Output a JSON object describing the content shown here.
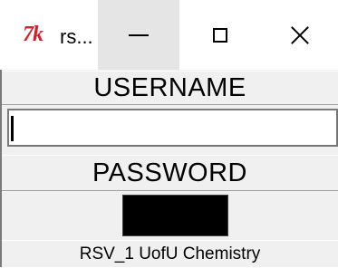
{
  "window": {
    "title": "rs...",
    "icon": "tk-icon",
    "icon_text": "7k",
    "controls": {
      "minimize": "minimize-icon",
      "maximize": "maximize-icon",
      "close": "close-icon"
    }
  },
  "form": {
    "username_label": "USERNAME",
    "username_value": "",
    "password_label": "PASSWORD"
  },
  "footer": {
    "text": "RSV_1 UofU Chemistry"
  },
  "colors": {
    "frame_bg": "#f0f0f0",
    "entry_bg": "#ffffff",
    "password_box": "#000000",
    "minimize_hover": "#e5e5e5",
    "icon_red": "#d4202a"
  }
}
